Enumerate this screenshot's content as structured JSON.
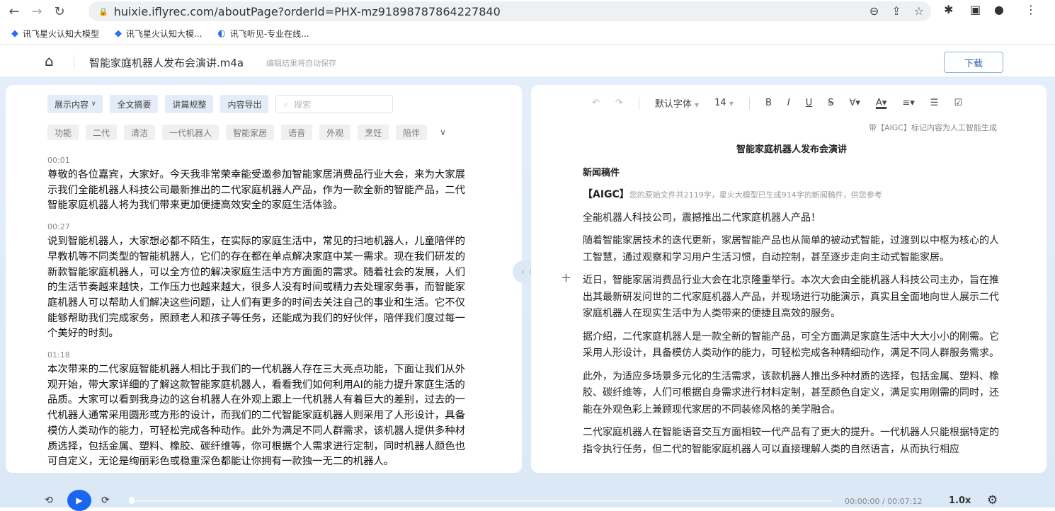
{
  "browser": {
    "url": "huixie.iflyrec.com/aboutPage?orderId=PHX-mz91898787864227840",
    "bookmarks": [
      "讯飞星火认知大模型",
      "讯飞星火认知大模...",
      "讯飞听见-专业在线..."
    ]
  },
  "header": {
    "file_name": "智能家庭机器人发布会演讲.m4a",
    "save_status": "编辑结果将自动保存",
    "download": "下载"
  },
  "left": {
    "toolbar": [
      "展示内容",
      "全文摘要",
      "讲篇规整",
      "内容导出"
    ],
    "search_placeholder": "搜索",
    "tags": [
      "功能",
      "二代",
      "清洁",
      "一代机器人",
      "智能家居",
      "语音",
      "外观",
      "烹饪",
      "陪伴"
    ],
    "segments": [
      {
        "time": "00:01",
        "text": "尊敬的各位嘉宾，大家好。今天我非常荣幸能受邀参加智能家居消费品行业大会，来为大家展示我们全能机器人科技公司最新推出的二代家庭机器人产品，作为一款全新的智能产品，二代智能家庭机器人将为我们带来更加便捷高效安全的家庭生活体验。"
      },
      {
        "time": "00:27",
        "text": "说到智能机器人，大家想必都不陌生，在实际的家庭生活中，常见的扫地机器人，儿童陪伴的早教机等不同类型的智能机器人，它们的存在都在单点解决家庭中某一需求。现在我们研发的新款智能家庭机器人，可以全方位的解决家庭生活中方方面面的需求。随着社会的发展，人们的生活节奏越来越快，工作压力也越来越大，很多人没有时间或精力去处理家务事，而智能家庭机器人可以帮助人们解决这些问题，让人们有更多的时间去关注自己的事业和生活。它不仅能够帮助我们完成家务，照顾老人和孩子等任务，还能成为我们的好伙伴，陪伴我们度过每一个美好的时刻。"
      },
      {
        "time": "01:18",
        "text": "本次带来的二代家庭智能机器人相比于我们的一代机器人存在三大亮点功能，下面让我们从外观开始，带大家详细的了解这款智能家庭机器人，看看我们如何利用AI的能力提升家庭生活的品质。大家可以看到我身边的这台机器人在外观上跟上一代机器人有着巨大的差别，过去的一代机器人通常采用圆形或方形的设计，而我们的二代智能家庭机器人则采用了人形设计，具备模仿人类动作的能力，可轻松完成各种动作。此外为满足不同人群需求，该机器人提供多种材质选择，包括金属、塑料、橡胶、碳纤维等，你可根据个人需求进行定制，同时机器人颜色也可自定义，无论是绚丽彩色或稳重深色都能让你拥有一款独一无二的机器人。"
      }
    ]
  },
  "editor": {
    "font": "默认字体",
    "size": "14",
    "aigc_note": "带【AIGC】标记内容为人工智能生成",
    "title": "智能家庭机器人发布会演讲",
    "heading": "新闻稿件",
    "aigc_tag": "【AIGC】",
    "aigc_text": "您的原始文件共2119字，星火大模型已生成914字的新闻稿件，供您参考",
    "paragraphs": [
      "全能机器人科技公司，震撼推出二代家庭机器人产品！",
      "随着智能家居技术的迭代更新，家居智能产品也从简单的被动式智能，过渡到以中枢为核心的人工智慧，通过观察和学习用户生活习惯，自动控制，甚至逐步走向主动式智能家居。",
      "近日，智能家居消费品行业大会在北京隆重举行。本次大会由全能机器人科技公司主办，旨在推出其最新研发问世的二代家庭机器人产品，并现场进行功能演示，真实且全面地向世人展示二代家庭机器人在现实生活中为人类带来的便捷且高效的服务。",
      "据介绍，二代家庭机器人是一款全新的智能产品，可全方面满足家庭生活中大大小小的刚需。它采用人形设计，具备模仿人类动作的能力，可轻松完成各种精细动作，满足不同人群服务需求。",
      "此外，为适应多场景多元化的生活需求，该款机器人推出多种材质的选择，包括金属、塑料、橡胶、碳纤维等，人们可根据自身需求进行材料定制，甚至颜色自定义，满足实用刚需的同时，还能在外观色彩上兼顾现代家居的不同装修风格的美学融合。",
      "二代家庭机器人在智能语音交互方面相较一代产品有了更大的提升。一代机器人只能根据特定的指令执行任务，但二代的智能家庭机器人可以直接理解人类的自然语言，从而执行相应"
    ]
  },
  "player": {
    "time": "00:00:00 / 00:07:12",
    "speed": "1.0x",
    "progress": 0
  }
}
